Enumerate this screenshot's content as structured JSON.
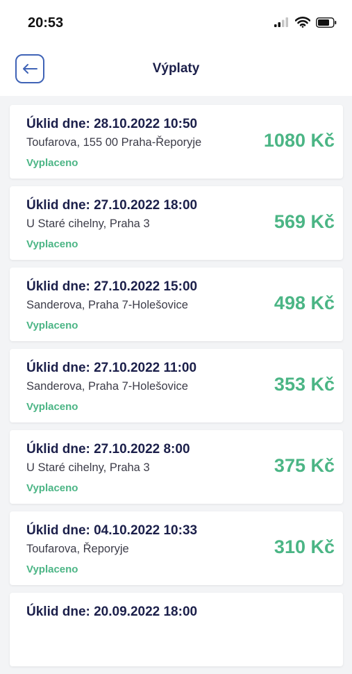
{
  "status_bar": {
    "time": "20:53"
  },
  "header": {
    "title": "Výplaty"
  },
  "payouts": [
    {
      "title": "Úklid dne: 28.10.2022 10:50",
      "address": "Toufarova, 155 00 Praha-Řeporyje",
      "status": "Vyplaceno",
      "amount": "1080 Kč"
    },
    {
      "title": "Úklid dne: 27.10.2022 18:00",
      "address": "U Staré cihelny, Praha 3",
      "status": "Vyplaceno",
      "amount": "569 Kč"
    },
    {
      "title": "Úklid dne: 27.10.2022 15:00",
      "address": "Sanderova, Praha 7-Holešovice",
      "status": "Vyplaceno",
      "amount": "498 Kč"
    },
    {
      "title": "Úklid dne: 27.10.2022 11:00",
      "address": "Sanderova, Praha 7-Holešovice",
      "status": "Vyplaceno",
      "amount": "353 Kč"
    },
    {
      "title": "Úklid dne: 27.10.2022 8:00",
      "address": "U Staré cihelny, Praha 3",
      "status": "Vyplaceno",
      "amount": "375 Kč"
    },
    {
      "title": "Úklid dne: 04.10.2022 10:33",
      "address": "Toufarova, Řeporyje",
      "status": "Vyplaceno",
      "amount": "310 Kč"
    },
    {
      "title": "Úklid dne: 20.09.2022 18:00"
    }
  ],
  "colors": {
    "accent_green": "#4bb585",
    "navy": "#1b1f4a",
    "back_border": "#3f63b6"
  },
  "icons": {
    "back": "arrow-left-icon",
    "signal": "signal-icon",
    "wifi": "wifi-icon",
    "battery": "battery-icon"
  }
}
